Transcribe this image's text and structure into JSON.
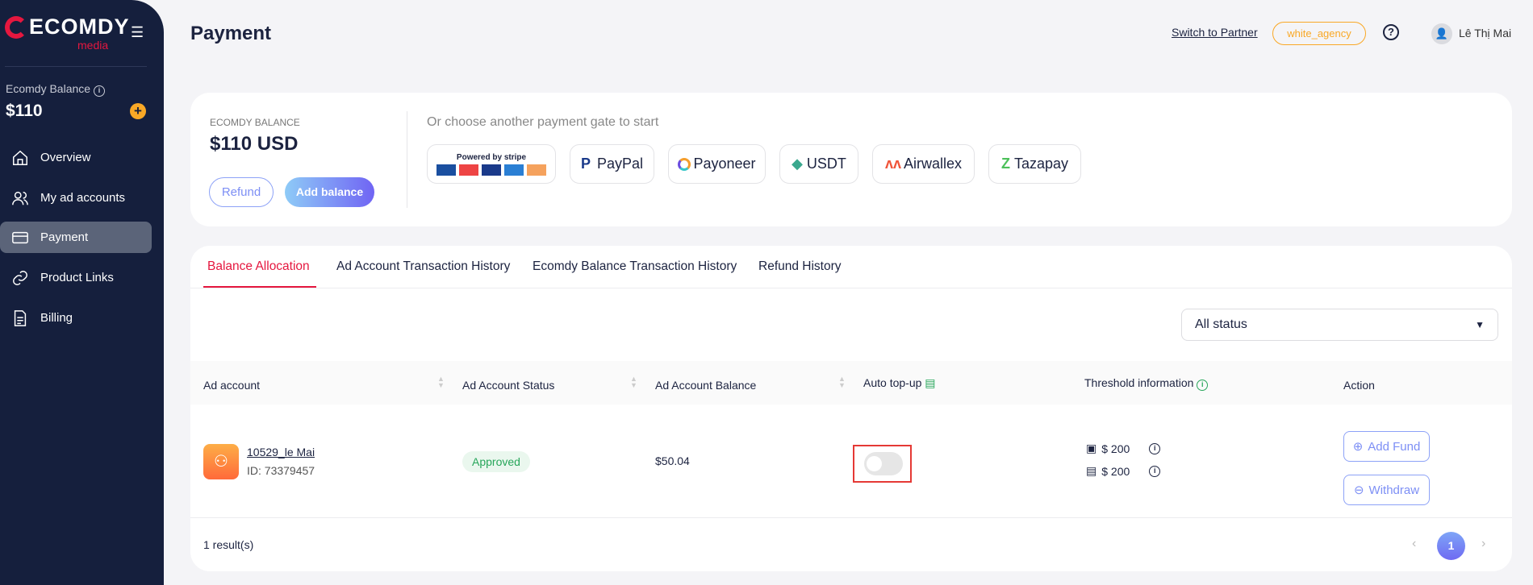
{
  "sidebar": {
    "logo": "ECOMDY",
    "logo_sub": "media",
    "balance_label": "Ecomdy Balance",
    "balance_value": "$110",
    "items": [
      {
        "label": "Overview",
        "icon": "home-icon"
      },
      {
        "label": "My ad accounts",
        "icon": "users-icon"
      },
      {
        "label": "Payment",
        "icon": "card-icon",
        "active": true
      },
      {
        "label": "Product Links",
        "icon": "link-icon"
      },
      {
        "label": "Billing",
        "icon": "document-icon"
      }
    ]
  },
  "header": {
    "title": "Payment",
    "switch_link": "Switch to Partner",
    "agency_chip": "white_agency",
    "user_name": "Lê Thị Mai"
  },
  "balance_card": {
    "label": "ECOMDY BALANCE",
    "value": "$110 USD",
    "refund": "Refund",
    "add_balance": "Add balance",
    "gate_prompt": "Or choose another payment gate to start",
    "gates": [
      {
        "label": "Powered by stripe"
      },
      {
        "label": "PayPal"
      },
      {
        "label": "Payoneer"
      },
      {
        "label": "USDT"
      },
      {
        "label": "Airwallex"
      },
      {
        "label": "Tazapay"
      }
    ]
  },
  "tabs": [
    {
      "label": "Balance Allocation",
      "active": true
    },
    {
      "label": "Ad Account Transaction History"
    },
    {
      "label": "Ecomdy Balance Transaction History"
    },
    {
      "label": "Refund History"
    }
  ],
  "filter": {
    "selected": "All status"
  },
  "table": {
    "columns": [
      "Ad account",
      "Ad Account Status",
      "Ad Account Balance",
      "Auto top-up",
      "Threshold information",
      "Action"
    ],
    "rows": [
      {
        "name": "10529_le Mai",
        "id": "ID: 73379457",
        "status": "Approved",
        "balance": "$50.04",
        "auto_topup": false,
        "threshold": "$ 200",
        "topup_amount": "$ 200",
        "add_fund": "Add Fund",
        "withdraw": "Withdraw"
      }
    ]
  },
  "footer": {
    "results": "1 result(s)",
    "page": "1"
  },
  "colors": {
    "sidebar": "#151f3d",
    "accent": "#e5173f",
    "primary": "#6e7ff3",
    "warning": "#f9a826",
    "success": "#27a65a"
  }
}
